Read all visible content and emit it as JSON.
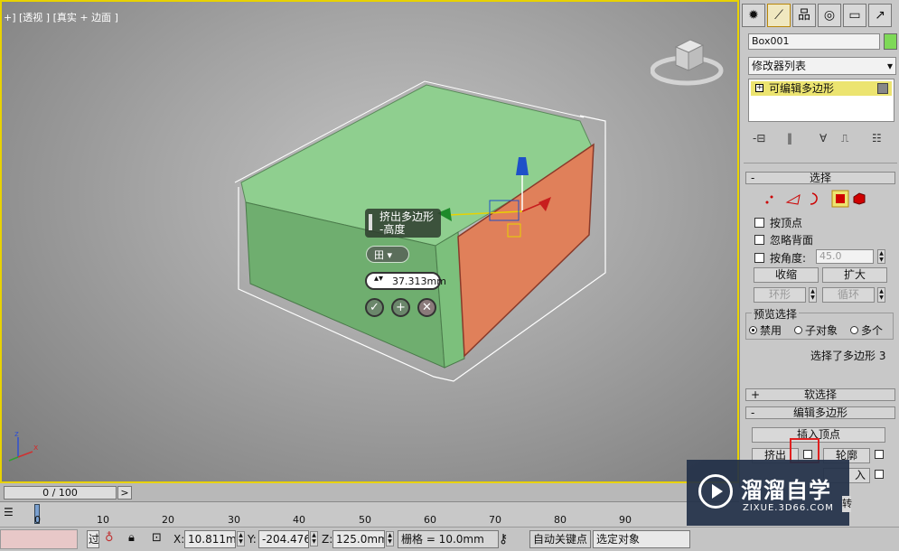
{
  "viewport": {
    "label": "+] [透视 ] [真实 + 边面 ]",
    "caddy_title": "挤出多边形",
    "caddy_subtitle": "-高度",
    "caddy_value": "37.313mm",
    "caddy_drop": "田 ▾",
    "ok_icon": "✓",
    "apply_icon": "+",
    "cancel_icon": "✕"
  },
  "panel": {
    "tabs": [
      "✹",
      "⟋",
      "品",
      "◎",
      "▭",
      "↗"
    ],
    "object_name": "Box001",
    "object_color": "#7ed957",
    "modifier_list_label": "修改器列表",
    "modifier_item": "可编辑多边形",
    "modifier_plus": "+",
    "stack_tools": [
      "-⊟",
      "‖",
      "∀",
      "⎍",
      "☷"
    ],
    "select_rollout": "选择",
    "by_vertex": "按顶点",
    "ignore_backface": "忽略背面",
    "by_angle": "按角度:",
    "angle_value": "45.0",
    "shrink": "收缩",
    "grow": "扩大",
    "ring": "环形",
    "loop": "循环",
    "preview_select": "预览选择",
    "preview_options": [
      "禁用",
      "子对象",
      "多个"
    ],
    "selection_status": "选择了多边形 3",
    "soft_select": "软选择",
    "edit_poly": "编辑多边形",
    "insert_vertex": "插入顶点",
    "extrude": "挤出",
    "outline": "轮廓",
    "insert": "入",
    "rotate": "转",
    "minus": "-",
    "plus_sign": "+"
  },
  "timeline": {
    "frame": "0 / 100",
    "next": ">",
    "ticks": [
      "0",
      "10",
      "20",
      "30",
      "40",
      "50",
      "60",
      "70",
      "80",
      "90"
    ]
  },
  "status": {
    "x_label": "X:",
    "x_value": "10.811mm",
    "y_label": "Y:",
    "y_value": "-204.476m",
    "z_label": "Z:",
    "z_value": "125.0mm",
    "grid": "栅格 = 10.0mm",
    "auto_key": "自动关键点",
    "selected": "选定对象",
    "left_char": "过"
  },
  "watermark": {
    "title": "溜溜自学",
    "subtitle": "ZIXUE.3D66.COM"
  },
  "colors": {
    "accent": "#e8d200",
    "box_top": "#8fcf8f",
    "box_front": "#6fae6f",
    "selected_face": "#e0805a",
    "highlight": "#ece470"
  }
}
